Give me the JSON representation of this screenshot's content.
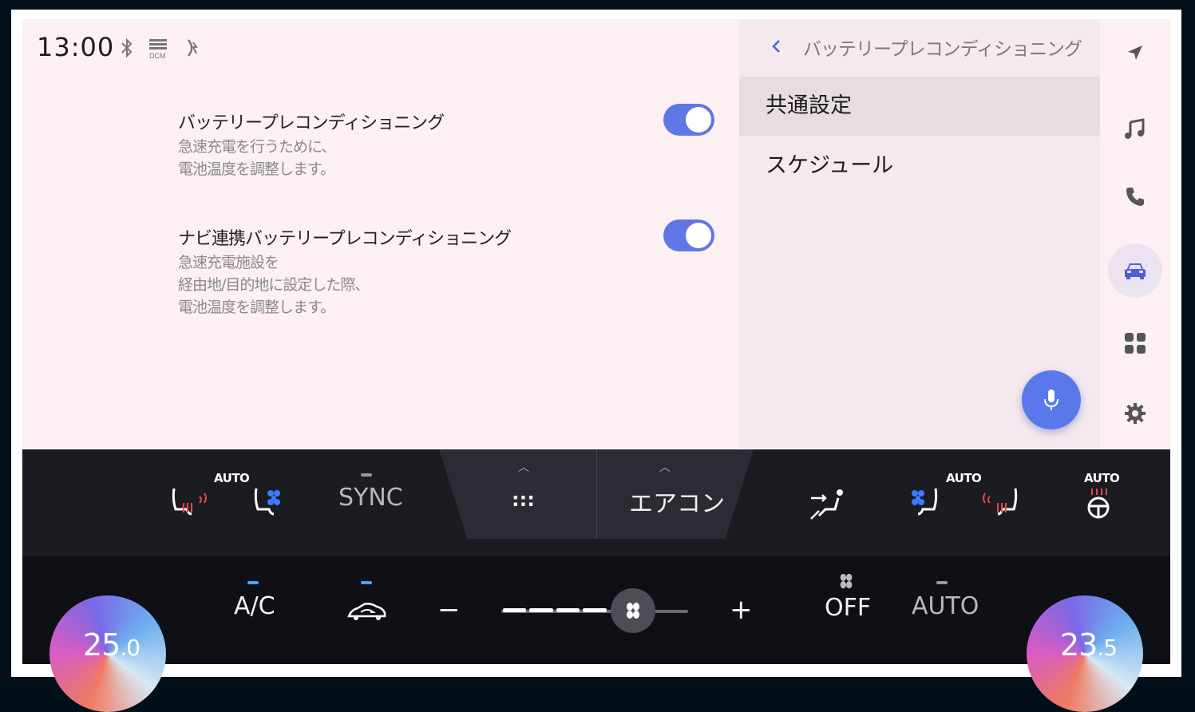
{
  "status": {
    "time": "13:00",
    "icons": [
      "bluetooth-icon",
      "dcm-icon",
      "wireless-charge-icon"
    ]
  },
  "settings": [
    {
      "title": "バッテリープレコンディショニング",
      "desc": [
        "急速充電を行うために、",
        "電池温度を調整します。"
      ],
      "on": true
    },
    {
      "title": "ナビ連携バッテリープレコンディショニング",
      "desc": [
        "急速充電施設を",
        "経由地/目的地に設定した際、",
        "電池温度を調整します。"
      ],
      "on": true
    }
  ],
  "panel": {
    "title": "バッテリープレコンディショニング",
    "menu": [
      {
        "label": "共通設定",
        "active": true
      },
      {
        "label": "スケジュール",
        "active": false
      }
    ]
  },
  "rail": [
    "navigation-icon",
    "music-icon",
    "phone-icon",
    "car-icon",
    "apps-icon",
    "settings-icon"
  ],
  "climate": {
    "seat_auto_left": "AUTO",
    "sync": "SYNC",
    "menu_dots": ":::",
    "aircon_label": "エアコン",
    "seat_auto_right": "AUTO",
    "wheel_auto": "AUTO",
    "ac": "A/C",
    "minus": "−",
    "plus": "+",
    "fan_off": "OFF",
    "auto": "AUTO",
    "temp_left": {
      "whole": "25",
      "decimal": ".0"
    },
    "temp_right": {
      "whole": "23",
      "decimal": ".5"
    },
    "fan_level": 5,
    "fan_max": 7
  },
  "colors": {
    "accent": "#6176e6",
    "mic": "#5a78ea",
    "indicator_blue": "#4aa3ff",
    "heat": "#e04a4a",
    "cool": "#3e7bff"
  }
}
